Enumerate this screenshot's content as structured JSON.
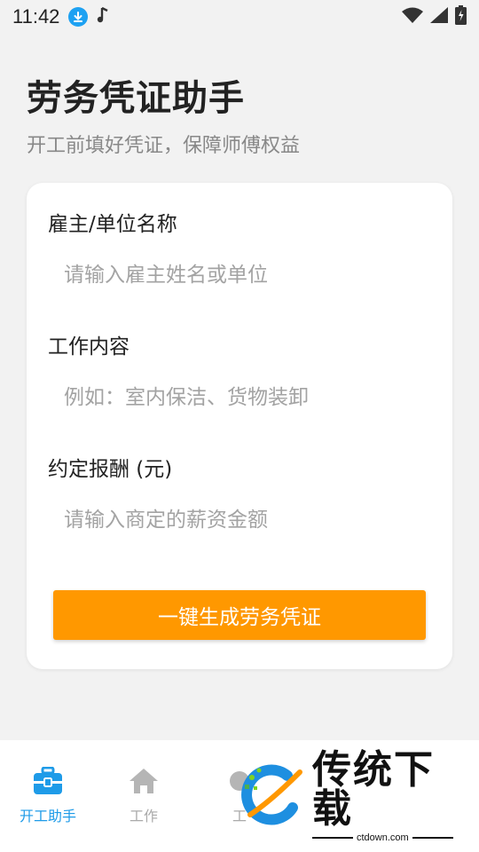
{
  "status_bar": {
    "time": "11:42",
    "icons": [
      "download-badge-icon",
      "music-note-icon",
      "wifi-icon",
      "cell-signal-icon",
      "battery-charging-icon"
    ]
  },
  "header": {
    "title": "劳务凭证助手",
    "subtitle": "开工前填好凭证，保障师傅权益"
  },
  "form": {
    "employer": {
      "label": "雇主/单位名称",
      "placeholder": "请输入雇主姓名或单位",
      "value": ""
    },
    "work": {
      "label": "工作内容",
      "placeholder": "例如：室内保洁、货物装卸",
      "value": ""
    },
    "pay": {
      "label": "约定报酬 (元)",
      "placeholder": "请输入商定的薪资金额",
      "value": ""
    },
    "submit_label": "一键生成劳务凭证"
  },
  "bottom_nav": {
    "items": [
      {
        "label": "开工助手",
        "icon": "toolbox-icon",
        "active": true
      },
      {
        "label": "工作",
        "icon": "home-icon",
        "active": false
      },
      {
        "label": "工",
        "icon": "partially-hidden-icon",
        "active": false
      }
    ]
  },
  "watermark": {
    "brand": "传统下载",
    "url": "ctdown.com"
  },
  "colors": {
    "accent": "#ff9800",
    "nav_active": "#1e9be8",
    "background": "#f2f2f2"
  }
}
